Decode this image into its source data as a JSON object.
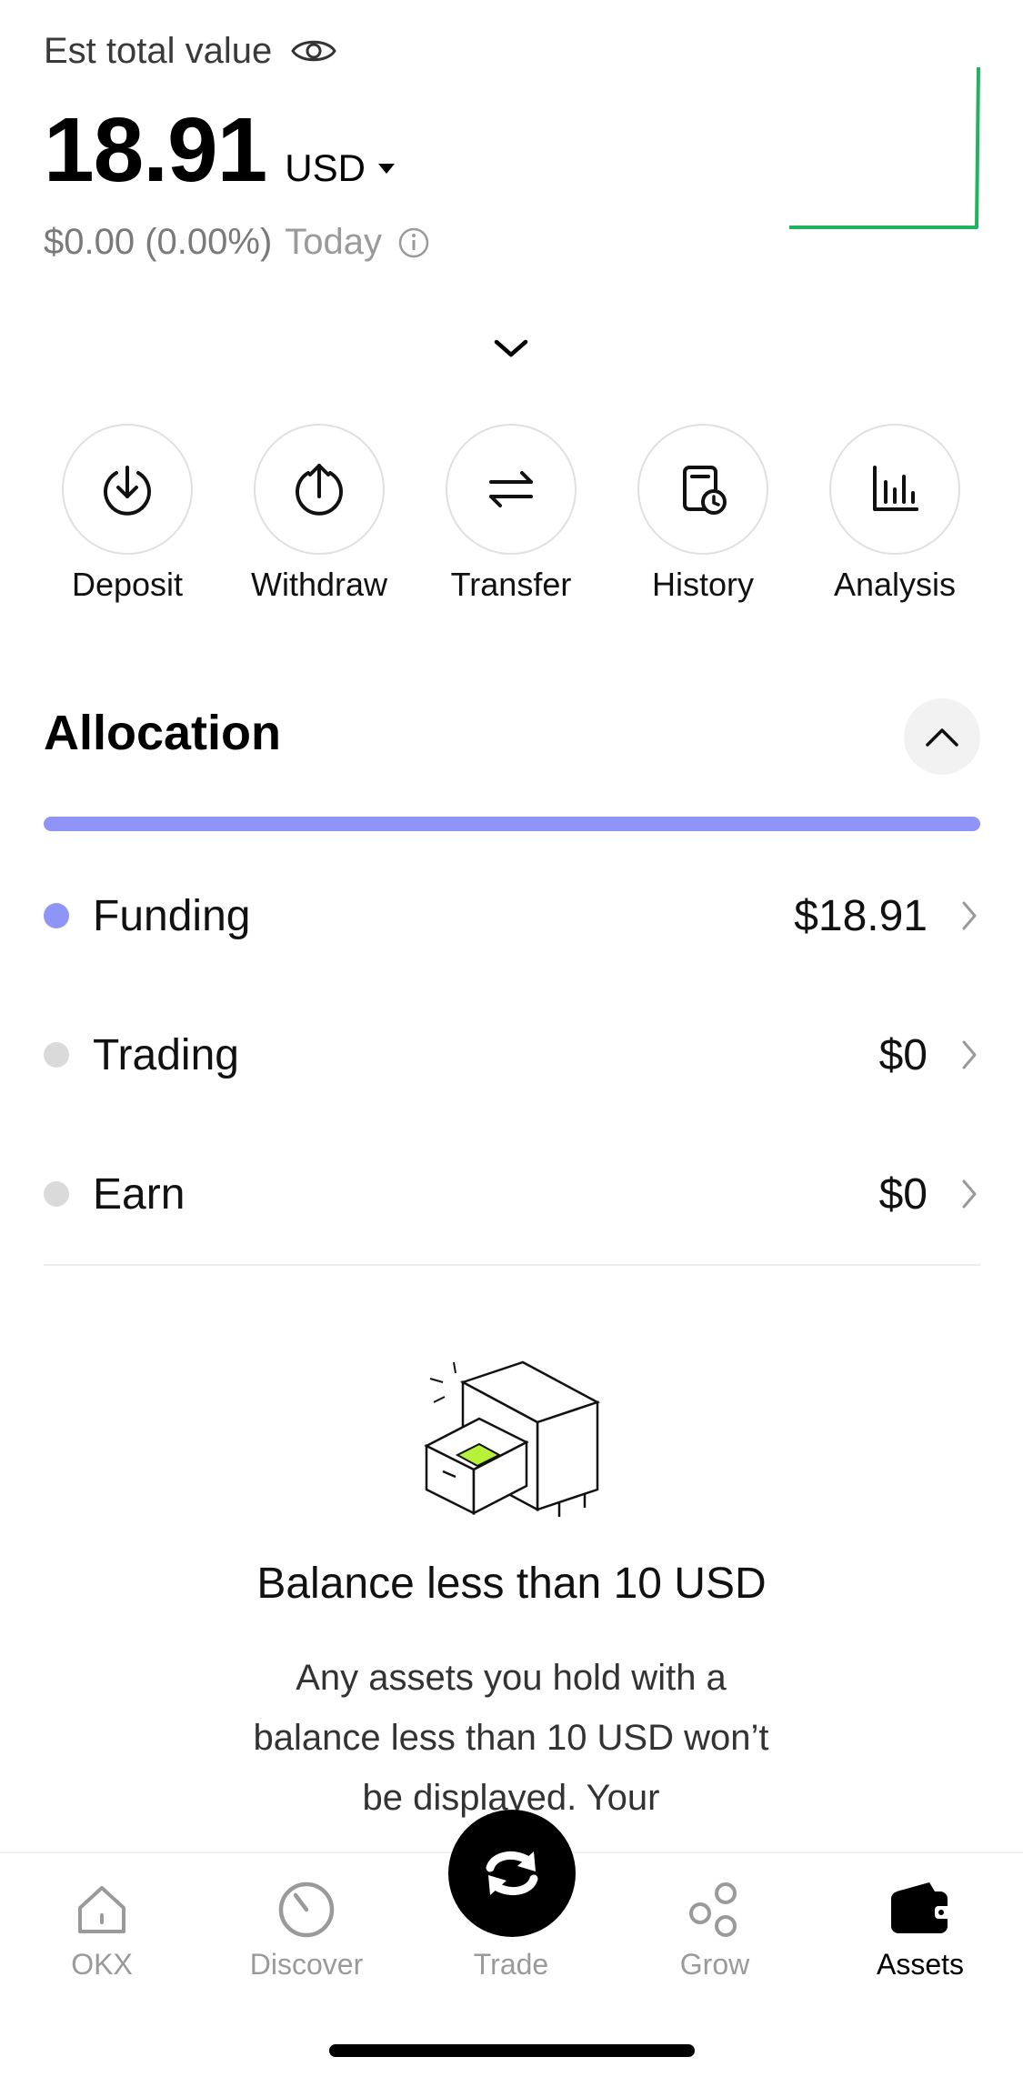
{
  "header": {
    "est_label": "Est total value",
    "total_value": "18.91",
    "currency": "USD",
    "change": "$0.00 (0.00%)",
    "period": "Today",
    "sparkline_color": "#22b35e"
  },
  "actions": [
    {
      "label": "Deposit",
      "icon": "deposit-icon"
    },
    {
      "label": "Withdraw",
      "icon": "withdraw-icon"
    },
    {
      "label": "Transfer",
      "icon": "transfer-icon"
    },
    {
      "label": "History",
      "icon": "history-icon"
    },
    {
      "label": "Analysis",
      "icon": "analysis-icon"
    }
  ],
  "allocation": {
    "title": "Allocation",
    "bar_color": "#8f95f7",
    "funding_share": 1.0,
    "rows": [
      {
        "name": "Funding",
        "value": "$18.91",
        "dot_color": "#8f95f7"
      },
      {
        "name": "Trading",
        "value": "$0",
        "dot_color": "#dadada"
      },
      {
        "name": "Earn",
        "value": "$0",
        "dot_color": "#dadada"
      }
    ]
  },
  "empty_state": {
    "title": "Balance less than 10 USD",
    "description": "Any assets you hold with a balance less than 10 USD won’t be displayed. Your"
  },
  "bottom_nav": {
    "items": [
      {
        "label": "OKX",
        "icon": "home-icon"
      },
      {
        "label": "Discover",
        "icon": "discover-icon"
      },
      {
        "label": "Trade",
        "icon": "trade-swap-icon"
      },
      {
        "label": "Grow",
        "icon": "grow-icon"
      },
      {
        "label": "Assets",
        "icon": "wallet-icon"
      }
    ],
    "active": "Assets"
  }
}
